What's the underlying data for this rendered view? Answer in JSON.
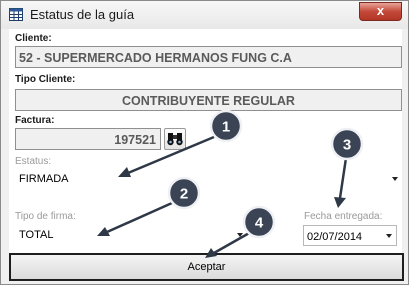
{
  "window": {
    "title": "Estatus de la guía",
    "close_label": "x"
  },
  "fields": {
    "cliente_label": "Cliente:",
    "cliente_value": "52 - SUPERMERCADO HERMANOS FUNG C.A",
    "tipo_cliente_label": "Tipo Cliente:",
    "tipo_cliente_value": "CONTRIBUYENTE REGULAR",
    "factura_label": "Factura:",
    "factura_value": "197521",
    "estatus_label": "Estatus:",
    "estatus_value": "FIRMADA",
    "tipo_firma_label": "Tipo de firma:",
    "tipo_firma_value": "TOTAL",
    "fecha_label": "Fecha entregada:",
    "fecha_value": "02/07/2014"
  },
  "buttons": {
    "accept_label": "Aceptar"
  },
  "callouts": [
    "1",
    "2",
    "3",
    "4"
  ],
  "colors": {
    "callout_fill": "#3a4455",
    "callout_border": "#eef0f4",
    "arrow": "#2e3846",
    "close_red": "#c4493a"
  }
}
